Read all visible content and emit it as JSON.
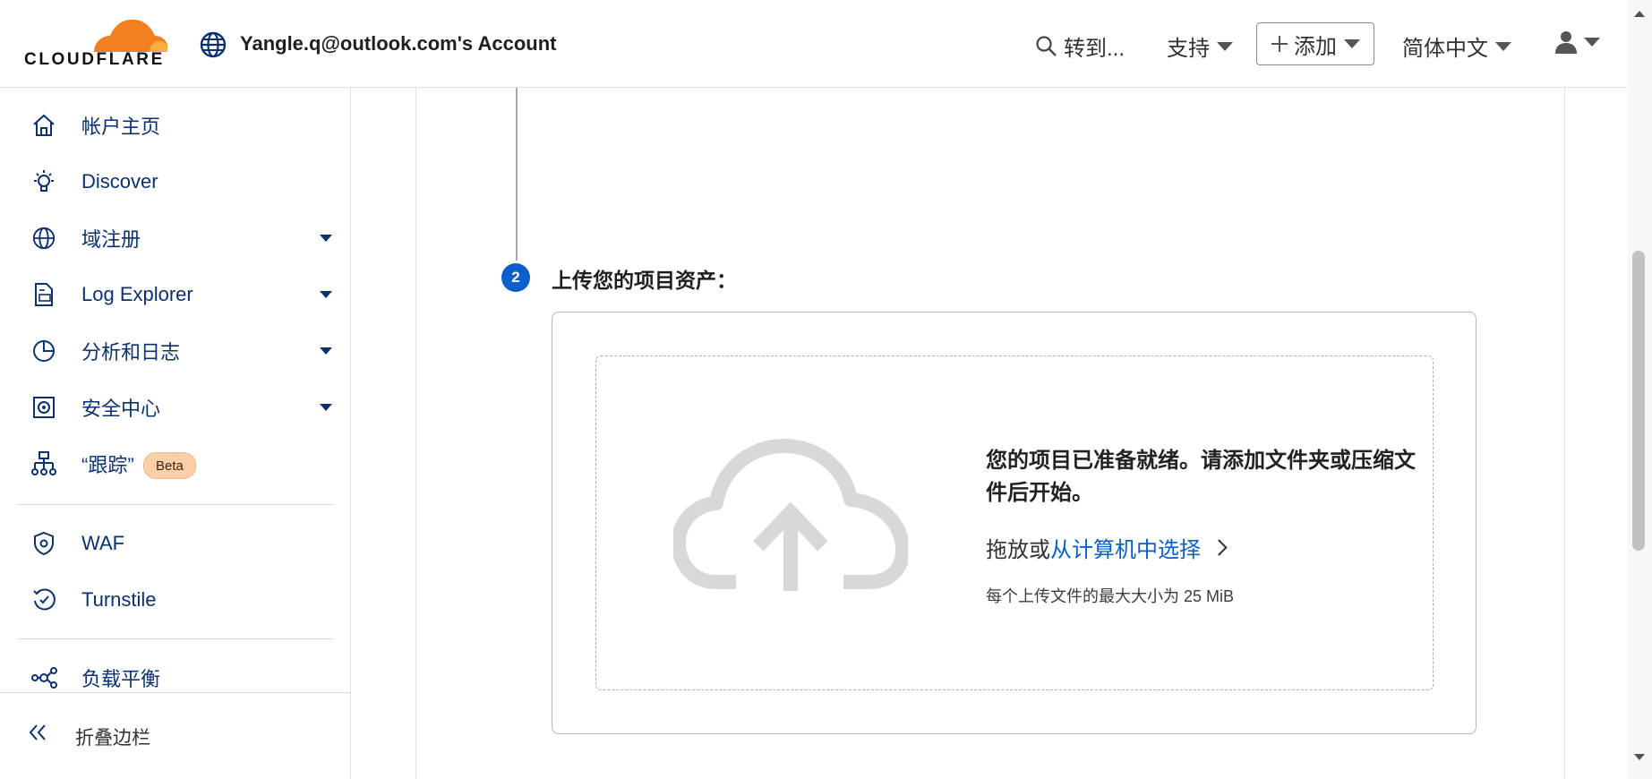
{
  "header": {
    "logo_text": "CLOUDFLARE",
    "account_name": "Yangle.q@outlook.com's Account",
    "goto_label": "转到...",
    "support_label": "支持",
    "add_label": "添加",
    "language_label": "简体中文",
    "user_icon": "user-icon"
  },
  "sidebar": {
    "items": [
      {
        "label": "帐户主页",
        "icon": "home-icon"
      },
      {
        "label": "Discover",
        "icon": "lightbulb-icon"
      },
      {
        "label": "域注册",
        "icon": "globe-icon"
      },
      {
        "label": "Log Explorer",
        "icon": "log-document-icon"
      },
      {
        "label": "分析和日志",
        "icon": "pie-chart-icon"
      },
      {
        "label": "安全中心",
        "icon": "safe-icon"
      },
      {
        "label": "“跟踪”",
        "icon": "sitemap-icon",
        "badge": "Beta"
      },
      {
        "label": "WAF",
        "icon": "shield-gear-icon"
      },
      {
        "label": "Turnstile",
        "icon": "turnstile-icon"
      },
      {
        "label": "负载平衡",
        "icon": "load-balancer-icon"
      }
    ],
    "collapse_label": "折叠边栏"
  },
  "main": {
    "step_number": "2",
    "step_title": "上传您的项目资产：",
    "upload": {
      "ready_text": "您的项目已准备就绪。请添加文件夹或压缩文件后开始。",
      "drop_prefix": "拖放或",
      "select_link": "从计算机中选择",
      "size_note": "每个上传文件的最大大小为 25 MiB"
    }
  },
  "colors": {
    "accent_blue": "#0b5fca",
    "nav_text": "#0b3170",
    "cloudflare_orange": "#f38020",
    "beta_badge": "#fbcfa8"
  }
}
